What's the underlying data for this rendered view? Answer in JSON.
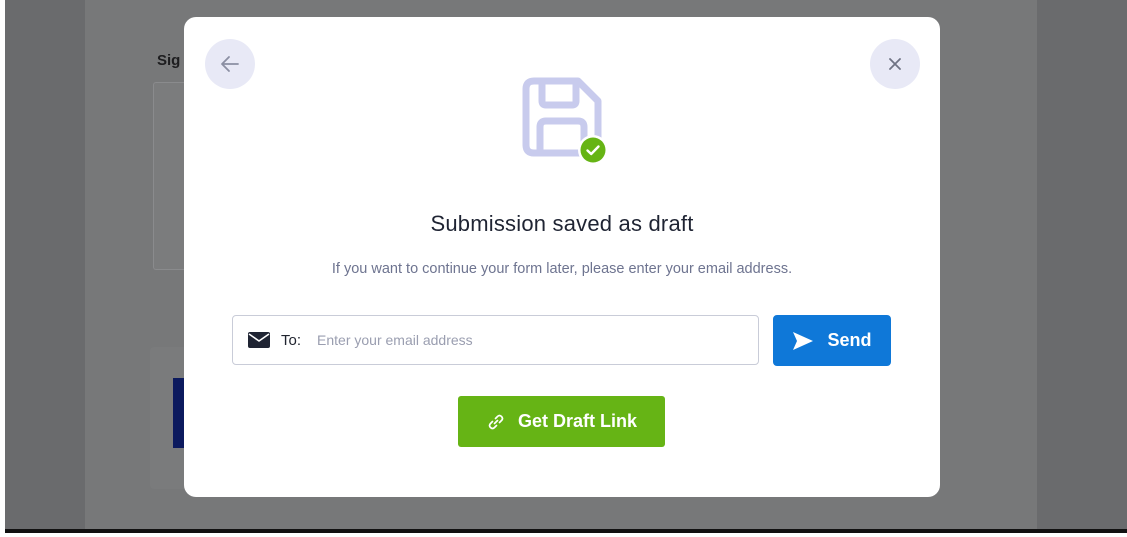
{
  "background": {
    "label": "Sig"
  },
  "modal": {
    "title": "Submission saved as draft",
    "subtitle": "If you want to continue your form later, please enter your email address.",
    "icons": {
      "back": "arrow-left-icon",
      "close": "close-icon",
      "hero": "save-disk-icon",
      "hero_badge": "check-circle-icon",
      "email": "envelope-icon",
      "send": "send-icon",
      "link": "link-icon"
    },
    "email_field": {
      "to_label": "To:",
      "value": "",
      "placeholder": "Enter your email address"
    },
    "send_button": {
      "label": "Send"
    },
    "draft_button": {
      "label": "Get Draft Link"
    }
  },
  "colors": {
    "overlay": "#6a6b6d",
    "primary_blue": "#0f78d8",
    "success_green": "#66b415",
    "icon_lavender": "#c8cbed",
    "text_dark": "#1f2433",
    "text_muted": "#6e7490"
  }
}
